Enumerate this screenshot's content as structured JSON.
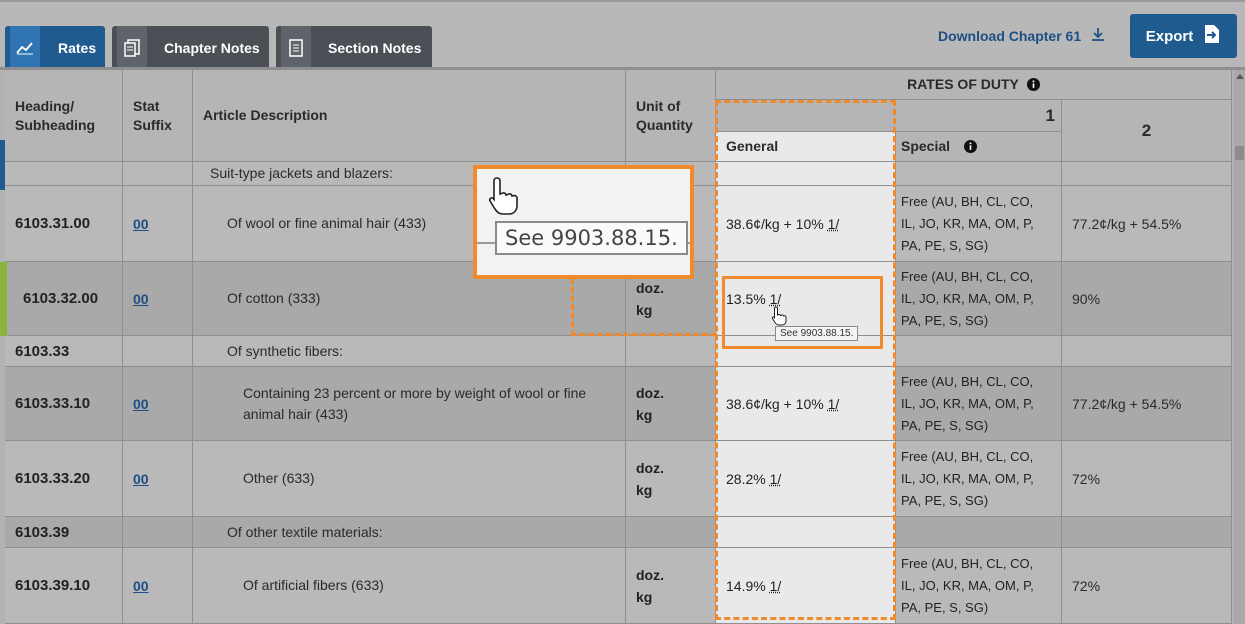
{
  "tabs": {
    "rates": "Rates",
    "chapter_notes": "Chapter Notes",
    "section_notes": "Section Notes"
  },
  "actions": {
    "download": "Download Chapter 61",
    "export": "Export"
  },
  "table": {
    "headers": {
      "heading": "Heading/ Subheading",
      "stat_suffix": "Stat Suffix",
      "article_description": "Article Description",
      "unit_of_quantity": "Unit of Quantity",
      "rates_of_duty": "RATES OF DUTY",
      "col1": "1",
      "col2": "2",
      "general": "General",
      "special": "Special"
    },
    "rows": [
      {
        "heading": "",
        "stat": "",
        "desc": "Suit-type jackets and blazers:",
        "unit": "",
        "general": "",
        "special": "",
        "col2": ""
      },
      {
        "heading": "6103.31.00",
        "stat": "00",
        "desc": "Of wool or fine animal hair (433)",
        "unit": "",
        "general": "38.6¢/kg + 10%",
        "footnote": "1/",
        "special": "Free (AU, BH, CL, CO, IL, JO, KR, MA, OM, P, PA, PE, S, SG)",
        "col2": "77.2¢/kg + 54.5%"
      },
      {
        "heading": "6103.32.00",
        "stat": "00",
        "desc": "Of cotton (333)",
        "unit": "doz. kg",
        "general": "13.5%",
        "footnote": "1/",
        "special": "Free (AU, BH, CL, CO, IL, JO, KR, MA, OM, P, PA, PE, S, SG)",
        "col2": "90%"
      },
      {
        "heading": "6103.33",
        "stat": "",
        "desc": "Of synthetic fibers:",
        "unit": "",
        "general": "",
        "special": "",
        "col2": ""
      },
      {
        "heading": "6103.33.10",
        "stat": "00",
        "desc": "Containing 23 percent or more by weight of wool or fine animal hair (433)",
        "unit": "doz. kg",
        "general": "38.6¢/kg + 10%",
        "footnote": "1/",
        "special": "Free (AU, BH, CL, CO, IL, JO, KR, MA, OM, P, PA, PE, S, SG)",
        "col2": "77.2¢/kg + 54.5%"
      },
      {
        "heading": "6103.33.20",
        "stat": "00",
        "desc": "Other (633)",
        "unit": "doz. kg",
        "general": "28.2%",
        "footnote": "1/",
        "special": "Free (AU, BH, CL, CO, IL, JO, KR, MA, OM, P, PA, PE, S, SG)",
        "col2": "72%"
      },
      {
        "heading": "6103.39",
        "stat": "",
        "desc": "Of other textile materials:",
        "unit": "",
        "general": "",
        "special": "",
        "col2": ""
      },
      {
        "heading": "6103.39.10",
        "stat": "00",
        "desc": "Of artificial fibers (633)",
        "unit": "doz. kg",
        "general": "14.9%",
        "footnote": "1/",
        "special": "Free (AU, BH, CL, CO, IL, JO, KR, MA, OM, P, PA, PE, S, SG)",
        "col2": "72%"
      }
    ]
  },
  "tooltip": {
    "text": "See 9903.88.15."
  },
  "colors": {
    "accent_blue": "#1f5b8f",
    "highlight_orange": "#f08a2c",
    "selected_row_marker": "#8ab33b"
  }
}
